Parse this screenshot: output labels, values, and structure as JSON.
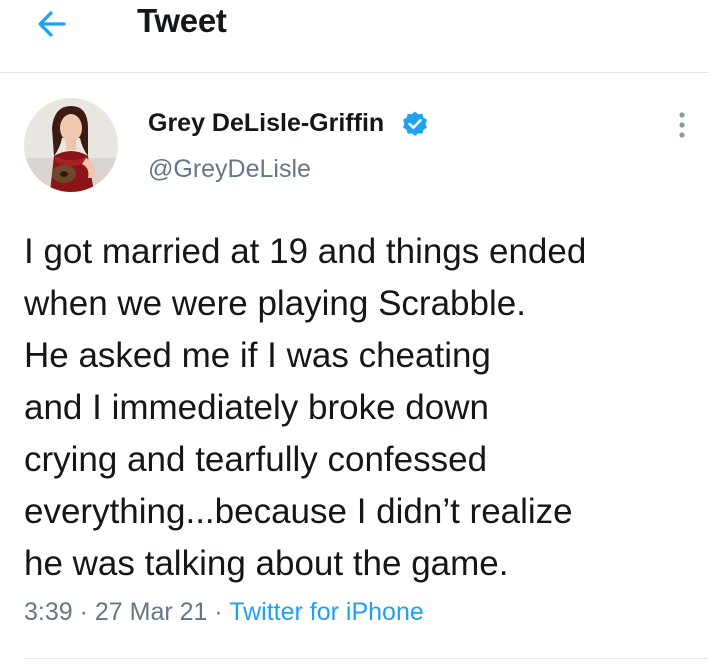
{
  "header": {
    "title": "Tweet",
    "back_icon": "arrow-left-icon"
  },
  "author": {
    "display_name": "Grey DeLisle-Griffin",
    "handle": "@GreyDeLisle",
    "verified": true,
    "verified_icon": "verified-badge-icon"
  },
  "tweet": {
    "lines": [
      "I got married at 19 and things ended",
      "when we were playing Scrabble.",
      "He asked me if I was cheating",
      "and I immediately broke down",
      "crying and tearfully confessed",
      "everything...because I didn’t realize",
      "he was talking about the game."
    ],
    "time": "3:39",
    "date": "27 Mar 21",
    "source": "Twitter for iPhone",
    "separator": " · "
  },
  "colors": {
    "accent": "#1da1f2",
    "text": "#14171a",
    "secondary": "#657786",
    "divider": "#e3e6e9"
  }
}
